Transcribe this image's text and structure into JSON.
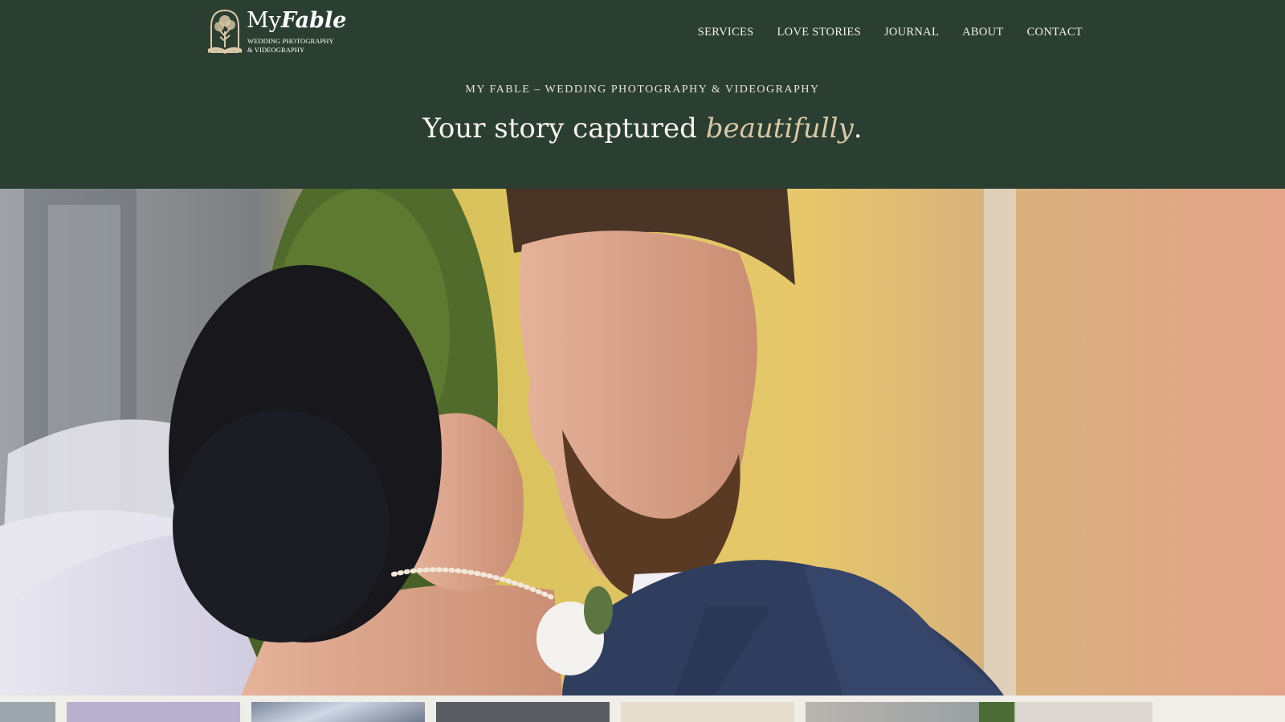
{
  "brand": {
    "name_part1": "My",
    "name_part2": "Fable",
    "tagline_line1": "WEDDING PHOTOGRAPHY",
    "tagline_line2": "& VIDEOGRAPHY"
  },
  "nav": {
    "items": [
      "SERVICES",
      "LOVE STORIES",
      "JOURNAL",
      "ABOUT",
      "CONTACT"
    ]
  },
  "hero": {
    "eyebrow": "MY FABLE – WEDDING PHOTOGRAPHY & VIDEOGRAPHY",
    "headline_main": "Your story captured ",
    "headline_accent": "beautifully",
    "headline_end": "."
  },
  "colors": {
    "header_bg": "#2a3e31",
    "accent_gold": "#d8c8a6",
    "text_light": "#f5f3ec"
  },
  "icons": {
    "logo": "tree-arch-book-icon"
  }
}
